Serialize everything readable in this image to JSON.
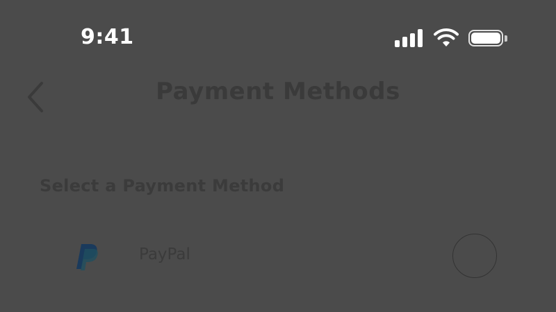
{
  "status_bar": {
    "time": "9:41",
    "icons": [
      "signal-icon",
      "wifi-icon",
      "battery-icon"
    ]
  },
  "header": {
    "title": "Payment Methods",
    "back_icon": "chevron-left-icon"
  },
  "section": {
    "label": "Select a Payment Method"
  },
  "payment_methods": [
    {
      "label": "PayPal",
      "icon": "paypal-icon",
      "selected": false
    }
  ],
  "colors": {
    "background": "#4b4b4b",
    "status_text": "#ffffff",
    "dim_text": "#3b3b3b"
  }
}
